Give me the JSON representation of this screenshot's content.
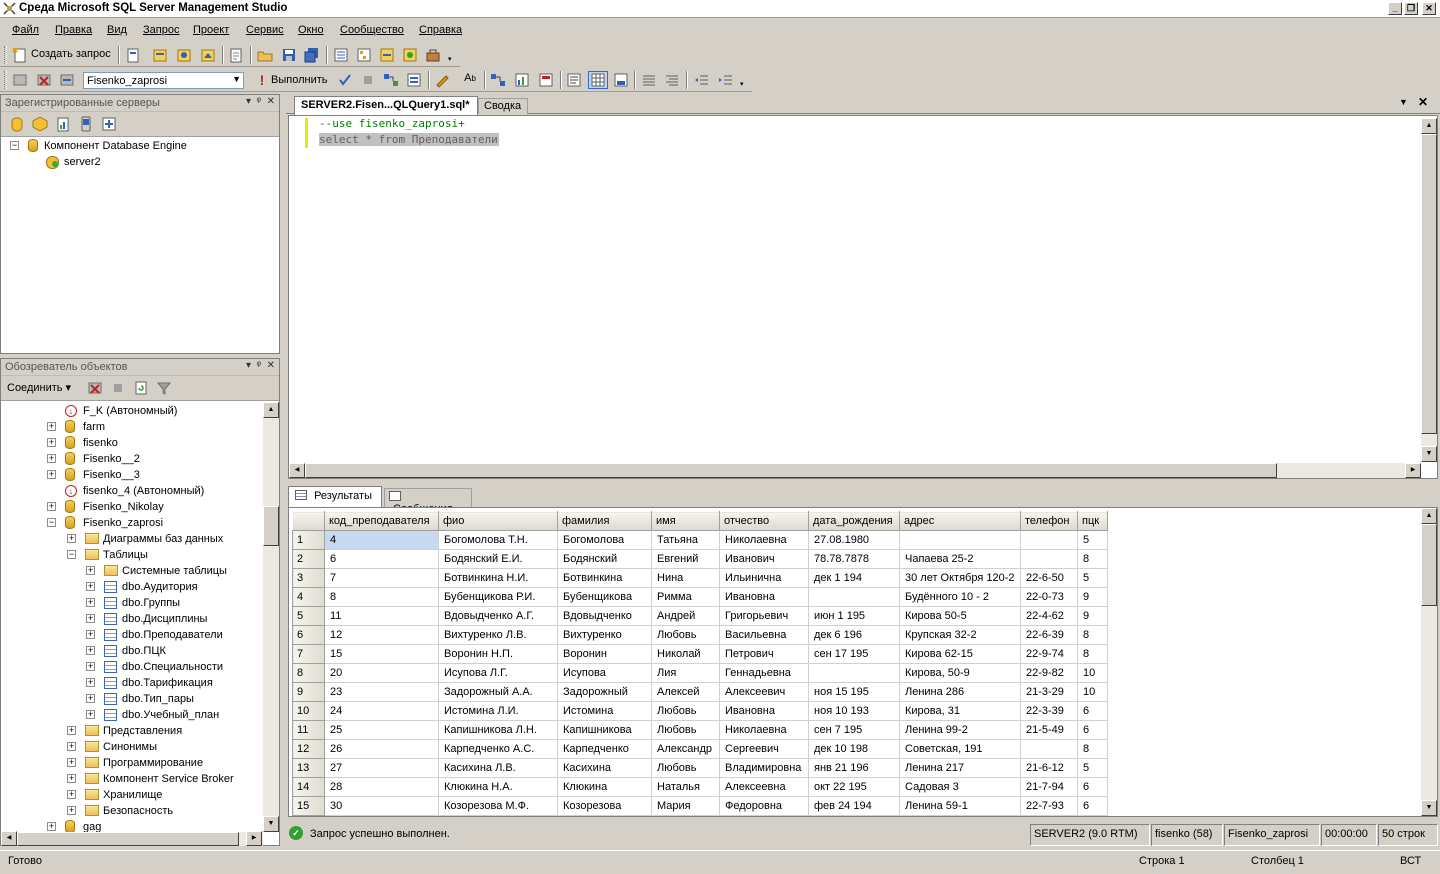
{
  "window": {
    "title": "Среда Microsoft SQL Server Management Studio"
  },
  "menu": [
    "Файл",
    "Правка",
    "Вид",
    "Запрос",
    "Проект",
    "Сервис",
    "Окно",
    "Сообщество",
    "Справка"
  ],
  "toolbar1": {
    "new_query": "Создать запрос"
  },
  "toolbar2": {
    "database": "Fisenko_zaprosi",
    "execute": "Выполнить"
  },
  "registered_servers": {
    "title": "Зарегистрированные серверы",
    "root": "Компонент Database Engine",
    "server": "server2"
  },
  "object_explorer": {
    "title": "Обозреватель объектов",
    "connect": "Соединить",
    "nodes": [
      {
        "label": "F_K (Автономный)",
        "type": "warn",
        "level": 0,
        "exp": ""
      },
      {
        "label": "farm",
        "type": "db",
        "level": 0,
        "exp": "+"
      },
      {
        "label": "fisenko",
        "type": "db",
        "level": 0,
        "exp": "+"
      },
      {
        "label": "Fisenko__2",
        "type": "db",
        "level": 0,
        "exp": "+"
      },
      {
        "label": "Fisenko__3",
        "type": "db",
        "level": 0,
        "exp": "+"
      },
      {
        "label": "fisenko_4 (Автономный)",
        "type": "warn",
        "level": 0,
        "exp": ""
      },
      {
        "label": "Fisenko_Nikolay",
        "type": "db",
        "level": 0,
        "exp": "+"
      },
      {
        "label": "Fisenko_zaprosi",
        "type": "db",
        "level": 0,
        "exp": "-"
      },
      {
        "label": "Диаграммы баз данных",
        "type": "folder",
        "level": 1,
        "exp": "+"
      },
      {
        "label": "Таблицы",
        "type": "folder",
        "level": 1,
        "exp": "-"
      },
      {
        "label": "Системные таблицы",
        "type": "folder",
        "level": 2,
        "exp": "+"
      },
      {
        "label": "dbo.Аудитория",
        "type": "table",
        "level": 2,
        "exp": "+"
      },
      {
        "label": "dbo.Группы",
        "type": "table",
        "level": 2,
        "exp": "+"
      },
      {
        "label": "dbo.Дисциплины",
        "type": "table",
        "level": 2,
        "exp": "+"
      },
      {
        "label": "dbo.Преподаватели",
        "type": "table",
        "level": 2,
        "exp": "+"
      },
      {
        "label": "dbo.ПЦК",
        "type": "table",
        "level": 2,
        "exp": "+"
      },
      {
        "label": "dbo.Специальности",
        "type": "table",
        "level": 2,
        "exp": "+"
      },
      {
        "label": "dbo.Тарификация",
        "type": "table",
        "level": 2,
        "exp": "+"
      },
      {
        "label": "dbo.Тип_пары",
        "type": "table",
        "level": 2,
        "exp": "+"
      },
      {
        "label": "dbo.Учебный_план",
        "type": "table",
        "level": 2,
        "exp": "+"
      },
      {
        "label": "Представления",
        "type": "folder",
        "level": 1,
        "exp": "+"
      },
      {
        "label": "Синонимы",
        "type": "folder",
        "level": 1,
        "exp": "+"
      },
      {
        "label": "Программирование",
        "type": "folder",
        "level": 1,
        "exp": "+"
      },
      {
        "label": "Компонент Service Broker",
        "type": "folder",
        "level": 1,
        "exp": "+"
      },
      {
        "label": "Хранилище",
        "type": "folder",
        "level": 1,
        "exp": "+"
      },
      {
        "label": "Безопасность",
        "type": "folder",
        "level": 1,
        "exp": "+"
      },
      {
        "label": "gag",
        "type": "db",
        "level": 0,
        "exp": "+"
      }
    ]
  },
  "editor": {
    "tab_active": "SERVER2.Fisen...QLQuery1.sql*",
    "tab_other": "Сводка",
    "line1": "--use fisenko_zaprosi+",
    "line2": "select * from Преподаватели"
  },
  "results": {
    "tab_results": "Результаты",
    "tab_messages": "Сообщения",
    "columns": [
      "код_преподавателя",
      "фио",
      "фамилия",
      "имя",
      "отчество",
      "дата_рождения",
      "адрес",
      "телефон",
      "пцк"
    ],
    "rows": [
      [
        "1",
        "4",
        "Богомолова Т.Н.",
        "Богомолова",
        "Татьяна",
        "Николаевна",
        "27.08.1980",
        "",
        "5"
      ],
      [
        "2",
        "6",
        "Бодянский Е.И.",
        "Бодянский",
        "Евгений",
        "Иванович",
        "78.78.7878",
        "Чапаева  25-2",
        "8"
      ],
      [
        "3",
        "7",
        "Ботвинкина Н.И.",
        "Ботвинкина",
        "Нина",
        "Ильинична",
        "дек  1 194",
        "30 лет Октября 120-2",
        "22-6-50",
        "5"
      ],
      [
        "4",
        "8",
        "Бубенщикова Р.И.",
        "Бубенщикова",
        "Римма",
        "Ивановна",
        "",
        "Будённого 10 - 2",
        "22-0-73",
        "9"
      ],
      [
        "5",
        "11",
        "Вдовыдченко А.Г.",
        "Вдовыдченко",
        "Андрей",
        "Григорьевич",
        "июн  1 195",
        "Кирова 50-5",
        "22-4-62",
        "9"
      ],
      [
        "6",
        "12",
        "Вихтуренко Л.В.",
        "Вихтуренко",
        "Любовь",
        "Васильевна",
        "дек  6 196",
        "Крупская 32-2",
        "22-6-39",
        "8"
      ],
      [
        "7",
        "15",
        "Воронин Н.П.",
        "Воронин",
        "Николай",
        "Петрович",
        "сен 17 195",
        "Кирова 62-15",
        "22-9-74",
        "8"
      ],
      [
        "8",
        "20",
        "Исупова Л.Г.",
        "Исупова",
        "Лия",
        "Геннадьевна",
        "",
        "Кирова, 50-9",
        "22-9-82",
        "10"
      ],
      [
        "9",
        "23",
        "Задорожный А.А.",
        "Задорожный",
        "Алексей",
        "Алексеевич",
        "ноя 15 195",
        "Ленина 286",
        "21-3-29",
        "10"
      ],
      [
        "10",
        "24",
        "Истомина Л.И.",
        "Истомина",
        "Любовь",
        "Ивановна",
        "ноя 10 193",
        "Кирова, 31",
        "22-3-39",
        "6"
      ],
      [
        "11",
        "25",
        "Капишникова Л.Н.",
        "Капишникова",
        "Любовь",
        "Николаевна",
        "сен  7 195",
        "Ленина 99-2",
        "21-5-49",
        "6"
      ],
      [
        "12",
        "26",
        "Карпедченко А.С.",
        "Карпедченко",
        "Александр",
        "Сергеевич",
        "дек 10 198",
        "Советская, 191",
        "",
        "8"
      ],
      [
        "13",
        "27",
        "Касихина Л.В.",
        "Касихина",
        "Любовь",
        "Владимировна",
        "янв 21 196",
        "Ленина 217",
        "21-6-12",
        "5"
      ],
      [
        "14",
        "28",
        "Клюкина Н.А.",
        "Клюкина",
        "Наталья",
        "Алексеевна",
        "окт 22 195",
        "Садовая 3",
        "21-7-94",
        "6"
      ],
      [
        "15",
        "30",
        "Козорезова М.Ф.",
        "Козорезова",
        "Мария",
        "Федоровна",
        "фев 24 194",
        "Ленина 59-1",
        "22-7-93",
        "6"
      ]
    ]
  },
  "query_status": {
    "message": "Запрос успешно выполнен.",
    "server": "SERVER2 (9.0 RTM)",
    "user": "fisenko (58)",
    "database": "Fisenko_zaprosi",
    "time": "00:00:00",
    "rows": "50 строк"
  },
  "statusbar": {
    "ready": "Готово",
    "line": "Строка 1",
    "col": "Столбец 1",
    "mode": "ВСТ"
  },
  "colors": {
    "selection": "#c8d8f0",
    "keyword": "#0000ff",
    "comment": "#008000"
  }
}
